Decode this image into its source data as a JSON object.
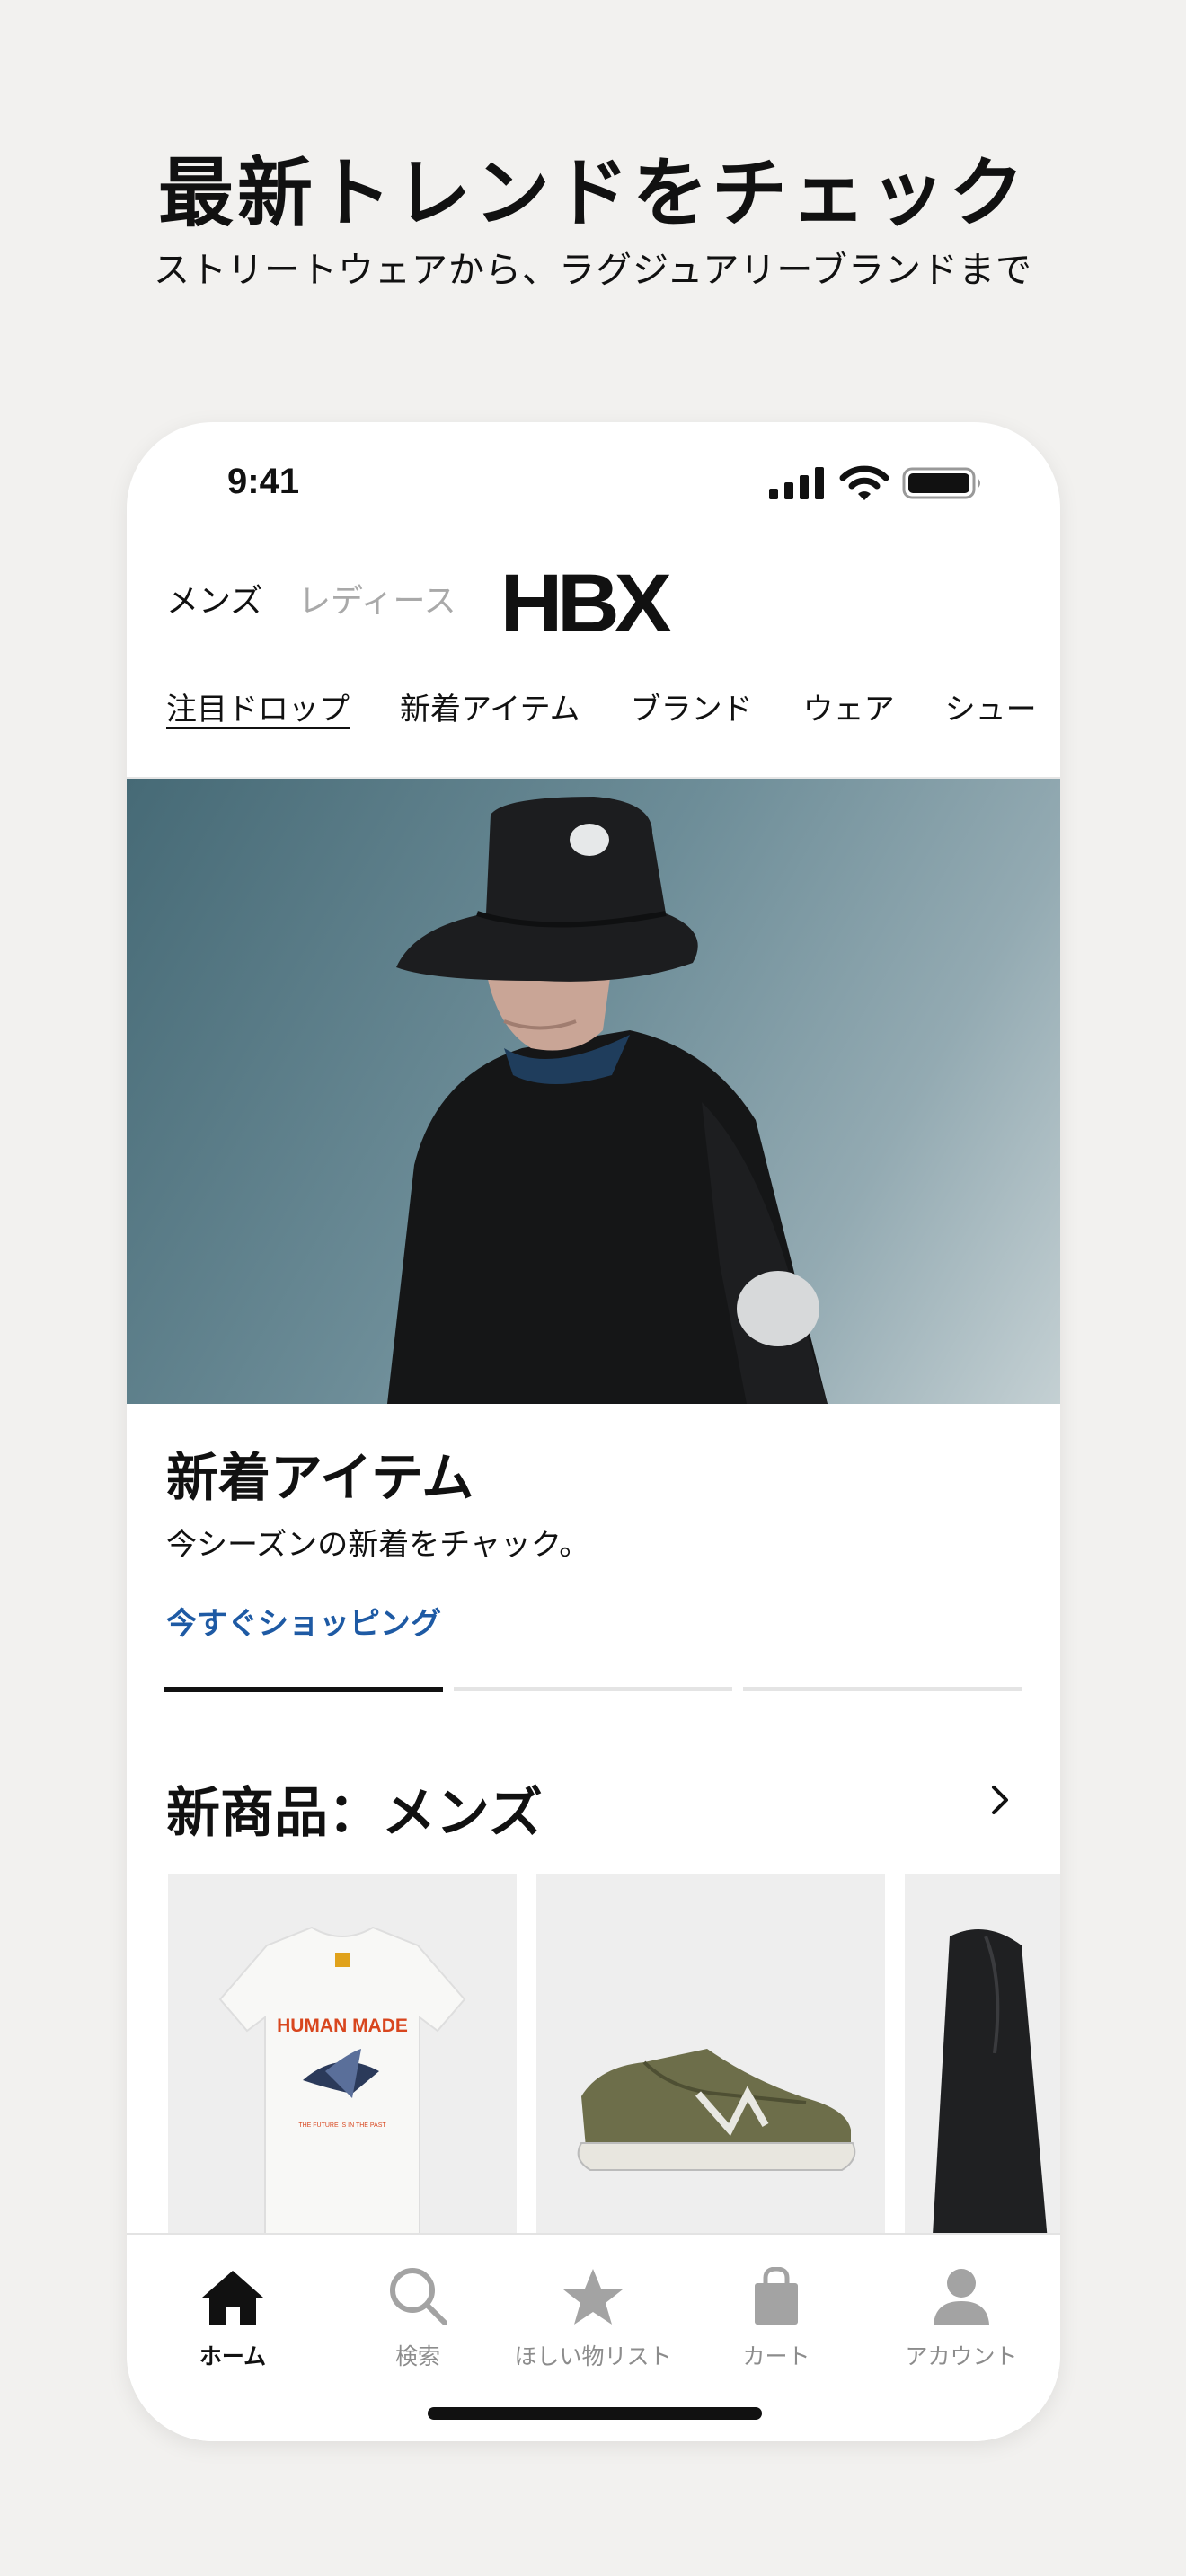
{
  "headline": "最新トレンドをチェック",
  "subheadline": "ストリートウェアから、ラグジュアリーブランドまで",
  "status_bar": {
    "time": "9:41"
  },
  "header": {
    "gender_tabs": [
      "メンズ",
      "レディース"
    ],
    "logo": "HBX"
  },
  "category_nav": [
    "注目ドロップ",
    "新着アイテム",
    "ブランド",
    "ウェア",
    "シュー"
  ],
  "hero": {
    "title": "新着アイテム",
    "subtitle": "今シーズンの新着をチャック。",
    "cta": "今すぐショッピング",
    "carousel_pages": 3,
    "carousel_active": 1
  },
  "section": {
    "title": "新商品：メンズ",
    "products": [
      {
        "name": "tshirt",
        "print_brand": "HUMAN MADE",
        "print_tagline": "THE FUTURE IS IN THE PAST"
      },
      {
        "name": "sneaker"
      },
      {
        "name": "jacket"
      }
    ]
  },
  "tabbar": {
    "items": [
      {
        "label": "ホーム",
        "icon": "home-icon"
      },
      {
        "label": "検索",
        "icon": "search-icon"
      },
      {
        "label": "ほしい物リスト",
        "icon": "star-icon"
      },
      {
        "label": "カート",
        "icon": "bag-icon"
      },
      {
        "label": "アカウント",
        "icon": "person-icon"
      }
    ],
    "active_index": 0
  },
  "colors": {
    "background": "#f2f1ef",
    "accent_link": "#1e5aa4",
    "text": "#111111",
    "muted": "#8c8c8c"
  }
}
